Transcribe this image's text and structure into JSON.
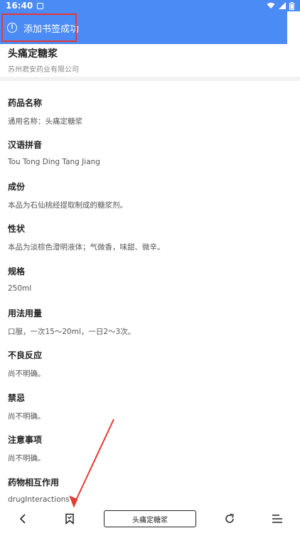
{
  "status_bar": {
    "time": "16:40"
  },
  "toast": {
    "message": "添加书签成功",
    "icon": "info-icon",
    "icon_glyph": "!"
  },
  "drug": {
    "title": "头痛定糖浆",
    "company": "苏州君安药业有限公司"
  },
  "sections": [
    {
      "heading": "药品名称",
      "body": "通用名称：头痛定糖浆"
    },
    {
      "heading": "汉语拼音",
      "body": "Tou Tong Ding Tang Jiang"
    },
    {
      "heading": "成份",
      "body": "本品为石仙桃经提取制成的糖浆剂。"
    },
    {
      "heading": "性状",
      "body": "本品为淡棕色澄明液体；气微香，味甜、微辛。"
    },
    {
      "heading": "规格",
      "body": "250ml"
    },
    {
      "heading": "用法用量",
      "body": "口服，一次15～20ml，一日2～3次。"
    },
    {
      "heading": "不良反应",
      "body": "尚不明确。"
    },
    {
      "heading": "禁忌",
      "body": "尚不明确。"
    },
    {
      "heading": "注意事项",
      "body": "尚不明确。"
    },
    {
      "heading": "药物相互作用",
      "body": "drugInteractions"
    }
  ],
  "bottom_bar": {
    "center_title": "头痛定糖浆",
    "icons": [
      "back-icon",
      "bookmark-icon",
      "refresh-icon",
      "menu-icon"
    ]
  },
  "colors": {
    "accent": "#4a8bf5",
    "highlight": "#e53935"
  }
}
